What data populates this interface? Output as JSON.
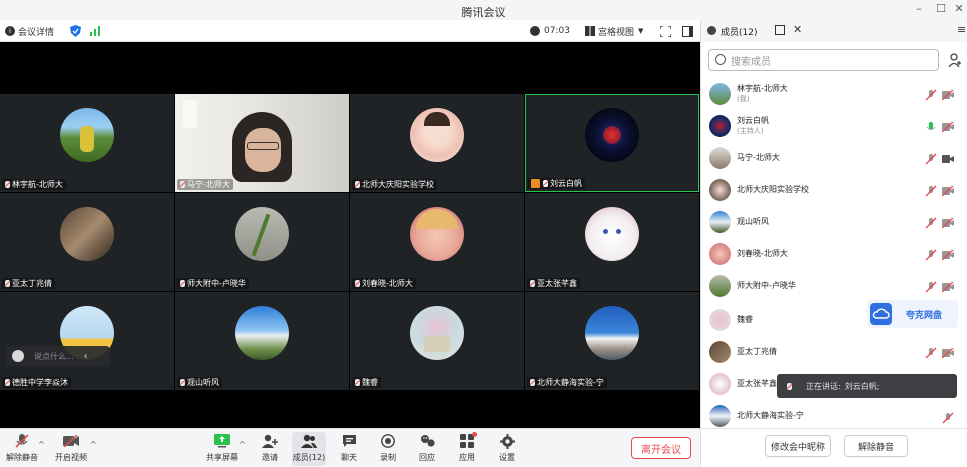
{
  "app": {
    "title": "腾讯会议"
  },
  "toolbar": {
    "meeting_info": "会议详情",
    "timer": "07:03",
    "view_mode": "宫格视图"
  },
  "tiles": [
    {
      "name": "林宇航-北师大"
    },
    {
      "name": "马宁-北师大"
    },
    {
      "name": "北师大庆阳实验学校"
    },
    {
      "name": "刘云白帆"
    },
    {
      "name": "亚太丁兆倩"
    },
    {
      "name": "师大附中-卢晓华"
    },
    {
      "name": "刘春晓-北师大"
    },
    {
      "name": "亚太张芊鑫"
    },
    {
      "name": "德胜中学李焱沐"
    },
    {
      "name": "观山听风"
    },
    {
      "name": "魏睿"
    },
    {
      "name": "北师大静海实验-宁"
    }
  ],
  "chat_input": {
    "placeholder": "说点什么..."
  },
  "bottom": {
    "unmute": "解除静音",
    "start_video": "开启视频",
    "share_screen": "共享屏幕",
    "invite": "邀请",
    "members": "成员(12)",
    "chat": "聊天",
    "record": "录制",
    "reactions": "回应",
    "apps": "应用",
    "settings": "设置",
    "leave": "离开会议"
  },
  "panel": {
    "title": "成员(12)",
    "search_placeholder": "搜索成员",
    "members": [
      {
        "name": "林宇航-北师大",
        "role": "(我)"
      },
      {
        "name": "刘云白帆",
        "role": "(主持人)"
      },
      {
        "name": "马宁-北师大",
        "role": ""
      },
      {
        "name": "北师大庆阳实验学校",
        "role": ""
      },
      {
        "name": "观山听风",
        "role": ""
      },
      {
        "name": "刘春晓-北师大",
        "role": ""
      },
      {
        "name": "师大附中-卢晓华",
        "role": ""
      },
      {
        "name": "魏睿",
        "role": ""
      },
      {
        "name": "亚太丁兆倩",
        "role": ""
      },
      {
        "name": "亚太张芊鑫",
        "role": ""
      },
      {
        "name": "北师大静海实验-宁",
        "role": ""
      }
    ],
    "rename_button": "修改会中昵称",
    "unmute_all_button": "解除静音"
  },
  "floating": {
    "quark_label": "夸克网盘",
    "speaking_label": "正在讲话:",
    "speaking_name": "刘云白帆;"
  },
  "colors": {
    "accent": "#1a73e8",
    "danger": "#e34d4d",
    "active_border": "#27c24c",
    "stage_bg": "#000000",
    "tile_bg": "#202326"
  }
}
